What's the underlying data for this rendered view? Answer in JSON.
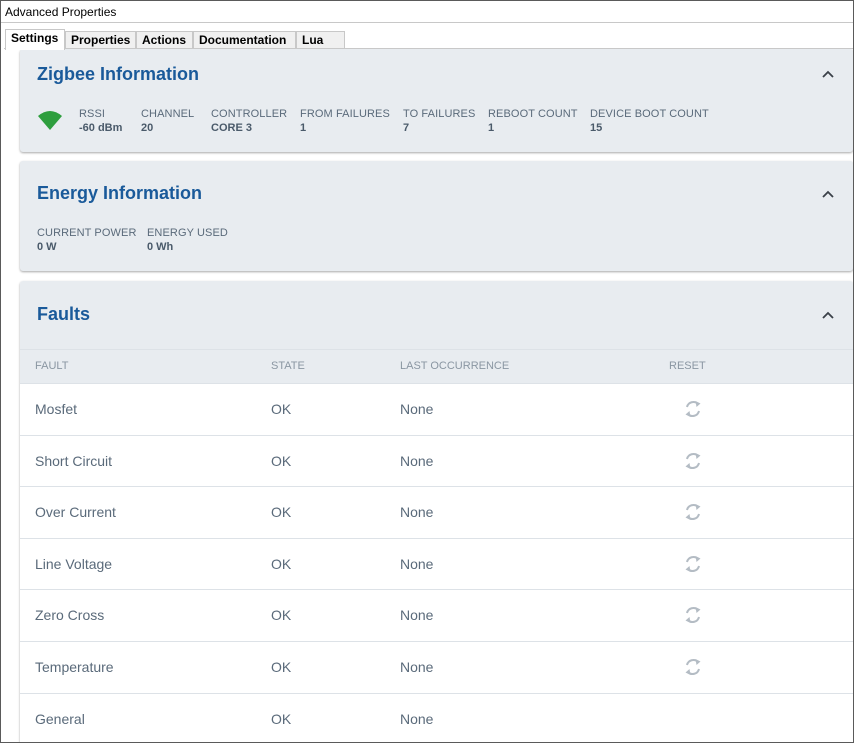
{
  "window": {
    "title": "Advanced Properties"
  },
  "tabs": [
    {
      "label": "Settings",
      "active": true
    },
    {
      "label": "Properties",
      "active": false
    },
    {
      "label": "Actions",
      "active": false
    },
    {
      "label": "Documentation",
      "active": false
    },
    {
      "label": "Lua",
      "active": false
    }
  ],
  "zigbee": {
    "title": "Zigbee Information",
    "signal_icon": "wifi-signal-icon",
    "signal_color": "#2e9e3e",
    "stats": [
      {
        "label": "RSSI",
        "value": "-60 dBm"
      },
      {
        "label": "CHANNEL",
        "value": "20"
      },
      {
        "label": "CONTROLLER",
        "value": "CORE 3"
      },
      {
        "label": "FROM FAILURES",
        "value": "1"
      },
      {
        "label": "TO FAILURES",
        "value": "7"
      },
      {
        "label": "REBOOT COUNT",
        "value": "1"
      },
      {
        "label": "DEVICE BOOT COUNT",
        "value": "15"
      }
    ]
  },
  "energy": {
    "title": "Energy Information",
    "stats": [
      {
        "label": "CURRENT POWER",
        "value": "0 W"
      },
      {
        "label": "ENERGY USED",
        "value": "0 Wh"
      }
    ]
  },
  "faults": {
    "title": "Faults",
    "columns": {
      "fault": "FAULT",
      "state": "STATE",
      "last": "LAST OCCURRENCE",
      "reset": "RESET"
    },
    "rows": [
      {
        "fault": "Mosfet",
        "state": "OK",
        "last": "None",
        "reset_icon": true
      },
      {
        "fault": "Short Circuit",
        "state": "OK",
        "last": "None",
        "reset_icon": true
      },
      {
        "fault": "Over Current",
        "state": "OK",
        "last": "None",
        "reset_icon": true
      },
      {
        "fault": "Line Voltage",
        "state": "OK",
        "last": "None",
        "reset_icon": true
      },
      {
        "fault": "Zero Cross",
        "state": "OK",
        "last": "None",
        "reset_icon": true
      },
      {
        "fault": "Temperature",
        "state": "OK",
        "last": "None",
        "reset_icon": true
      },
      {
        "fault": "General",
        "state": "OK",
        "last": "None",
        "reset_icon": false
      }
    ]
  },
  "colors": {
    "accent": "#1a5a9a",
    "panel_bg": "#e8ecf0",
    "text": "#5a6a7a"
  }
}
